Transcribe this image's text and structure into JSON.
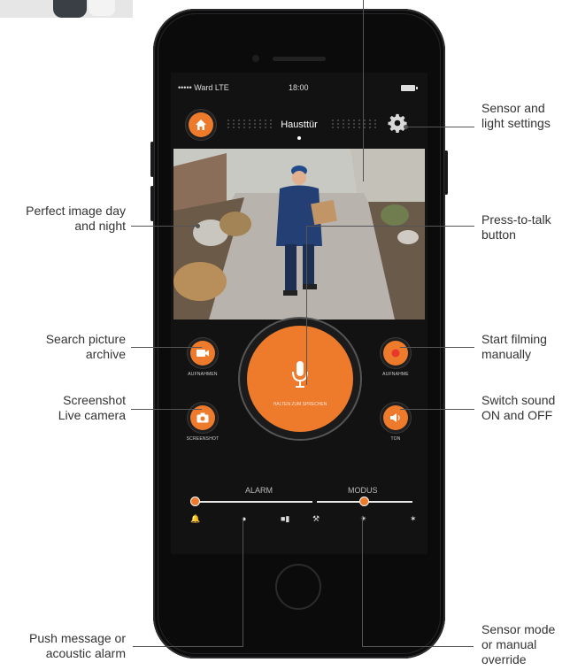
{
  "annotations": {
    "sensor_settings": "Sensor and\nlight settings",
    "perfect_image": "Perfect image day\nand night",
    "press_to_talk": "Press-to-talk\nbutton",
    "search_archive": "Search picture\narchive",
    "start_filming": "Start filming\nmanually",
    "screenshot": "Screenshot\nLive camera",
    "switch_sound": "Switch sound\nON and OFF",
    "push_message": "Push message or\nacoustic alarm",
    "sensor_mode": "Sensor mode\nor manual\noverride"
  },
  "status_bar": {
    "carrier": "••••• Ward LTE",
    "time": "18:00"
  },
  "header": {
    "camera_name": "Hausttür"
  },
  "buttons": {
    "archive_label": "AUFNAHMEN",
    "record_label": "AUFNAHME",
    "screenshot_label": "SCREENSHOT",
    "sound_label": "TON",
    "talk_label": "HALTEN ZUM SPRECHEN"
  },
  "controls": {
    "alarm_title": "ALARM",
    "mode_title": "MODUS"
  },
  "colors": {
    "accent": "#ee7a2c",
    "screen_bg": "#121212",
    "frame": "#0b0b0c"
  },
  "icons": [
    "home-icon",
    "gear-icon",
    "video-icon",
    "record-icon",
    "camera-icon",
    "speaker-icon",
    "microphone-icon",
    "bell-icon",
    "chat-icon",
    "siren-icon",
    "wrench-icon",
    "motion-icon",
    "person-icon"
  ]
}
